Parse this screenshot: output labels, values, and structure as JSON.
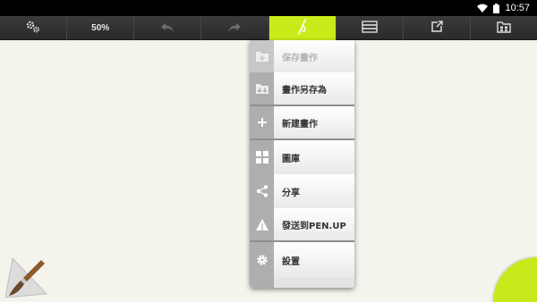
{
  "status_bar": {
    "time": "10:57",
    "icons": [
      "wifi-icon",
      "battery-icon"
    ]
  },
  "toolbar": {
    "buttons": [
      {
        "icon": "settings-gears-icon"
      },
      {
        "label": "50%"
      },
      {
        "icon": "undo-icon",
        "enabled": false
      },
      {
        "icon": "redo-icon",
        "enabled": false
      },
      {
        "icon": "pen-tool-icon",
        "active": true
      },
      {
        "icon": "layers-icon"
      },
      {
        "icon": "export-icon"
      },
      {
        "icon": "gallery-folder-icon"
      }
    ],
    "zoom": "50%"
  },
  "menu": {
    "items": [
      {
        "label": "保存畫作",
        "icon": "save-folder-icon",
        "enabled": false
      },
      {
        "label": "畫作另存為",
        "icon": "save-as-folder-icon",
        "enabled": true
      },
      {
        "label": "新建畫作",
        "icon": "plus-icon",
        "enabled": true
      },
      {
        "label": "圖庫",
        "icon": "grid-icon",
        "enabled": true
      },
      {
        "label": "分享",
        "icon": "share-icon",
        "enabled": true
      },
      {
        "label": "發送到PEN.UP",
        "icon": "penup-triangle-icon",
        "enabled": true
      },
      {
        "label": "設置",
        "icon": "gear-icon",
        "enabled": true
      }
    ]
  },
  "colors": {
    "accent": "#c8ec1a",
    "canvas": "#f5f4ec",
    "toolbar": "#333333"
  }
}
